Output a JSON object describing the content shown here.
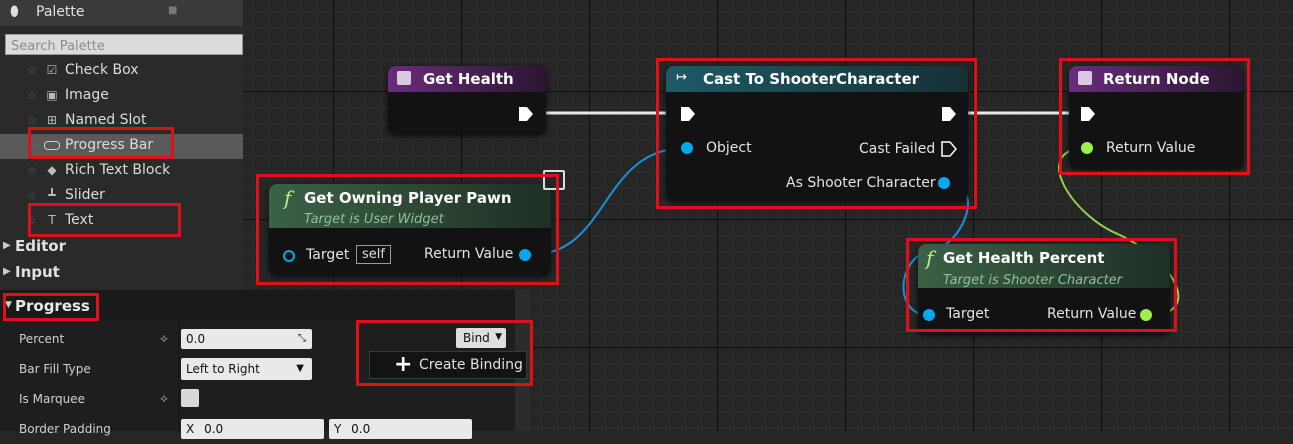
{
  "palette": {
    "title": "Palette",
    "search_placeholder": "Search Palette",
    "items": [
      {
        "label": "Check Box",
        "icon": "check-box-icon"
      },
      {
        "label": "Image",
        "icon": "image-icon"
      },
      {
        "label": "Named Slot",
        "icon": "named-slot-icon"
      },
      {
        "label": "Progress Bar",
        "icon": "progress-bar-icon",
        "selected": true
      },
      {
        "label": "Rich Text Block",
        "icon": "rich-text-icon"
      },
      {
        "label": "Slider",
        "icon": "slider-icon"
      },
      {
        "label": "Text",
        "icon": "text-icon"
      }
    ],
    "categories": [
      "Editor",
      "Input"
    ]
  },
  "details": {
    "section": "Progress",
    "rows": [
      {
        "name": "Percent",
        "value": "0.0"
      },
      {
        "name": "Bar Fill Type",
        "value": "Left to Right"
      },
      {
        "name": "Is Marquee",
        "value": ""
      },
      {
        "name": "Border Padding",
        "x_label": "X",
        "x": "0.0",
        "y_label": "Y",
        "y": "0.0"
      }
    ],
    "bind_label": "Bind",
    "create_binding_label": "Create Binding"
  },
  "nodes": {
    "get_health": {
      "title": "Get Health"
    },
    "cast": {
      "title": "Cast To ShooterCharacter",
      "object": "Object",
      "cast_failed": "Cast Failed",
      "as_shooter": "As Shooter Character"
    },
    "return_node": {
      "title": "Return Node",
      "return_value": "Return Value"
    },
    "owning_pawn": {
      "title": "Get Owning Player Pawn",
      "subtitle": "Target is User Widget",
      "target": "Target",
      "self": "self",
      "return_value": "Return Value"
    },
    "health_percent": {
      "title": "Get Health Percent",
      "subtitle": "Target is Shooter Character",
      "target": "Target",
      "return_value": "Return Value"
    }
  },
  "colors": {
    "highlight": "#e0101a",
    "object_pin": "#00a8f0",
    "float_pin": "#9cf04a",
    "pure_header": "#3b6146",
    "cast_header": "#1d5a66",
    "event_header": "#6a2c7d"
  }
}
